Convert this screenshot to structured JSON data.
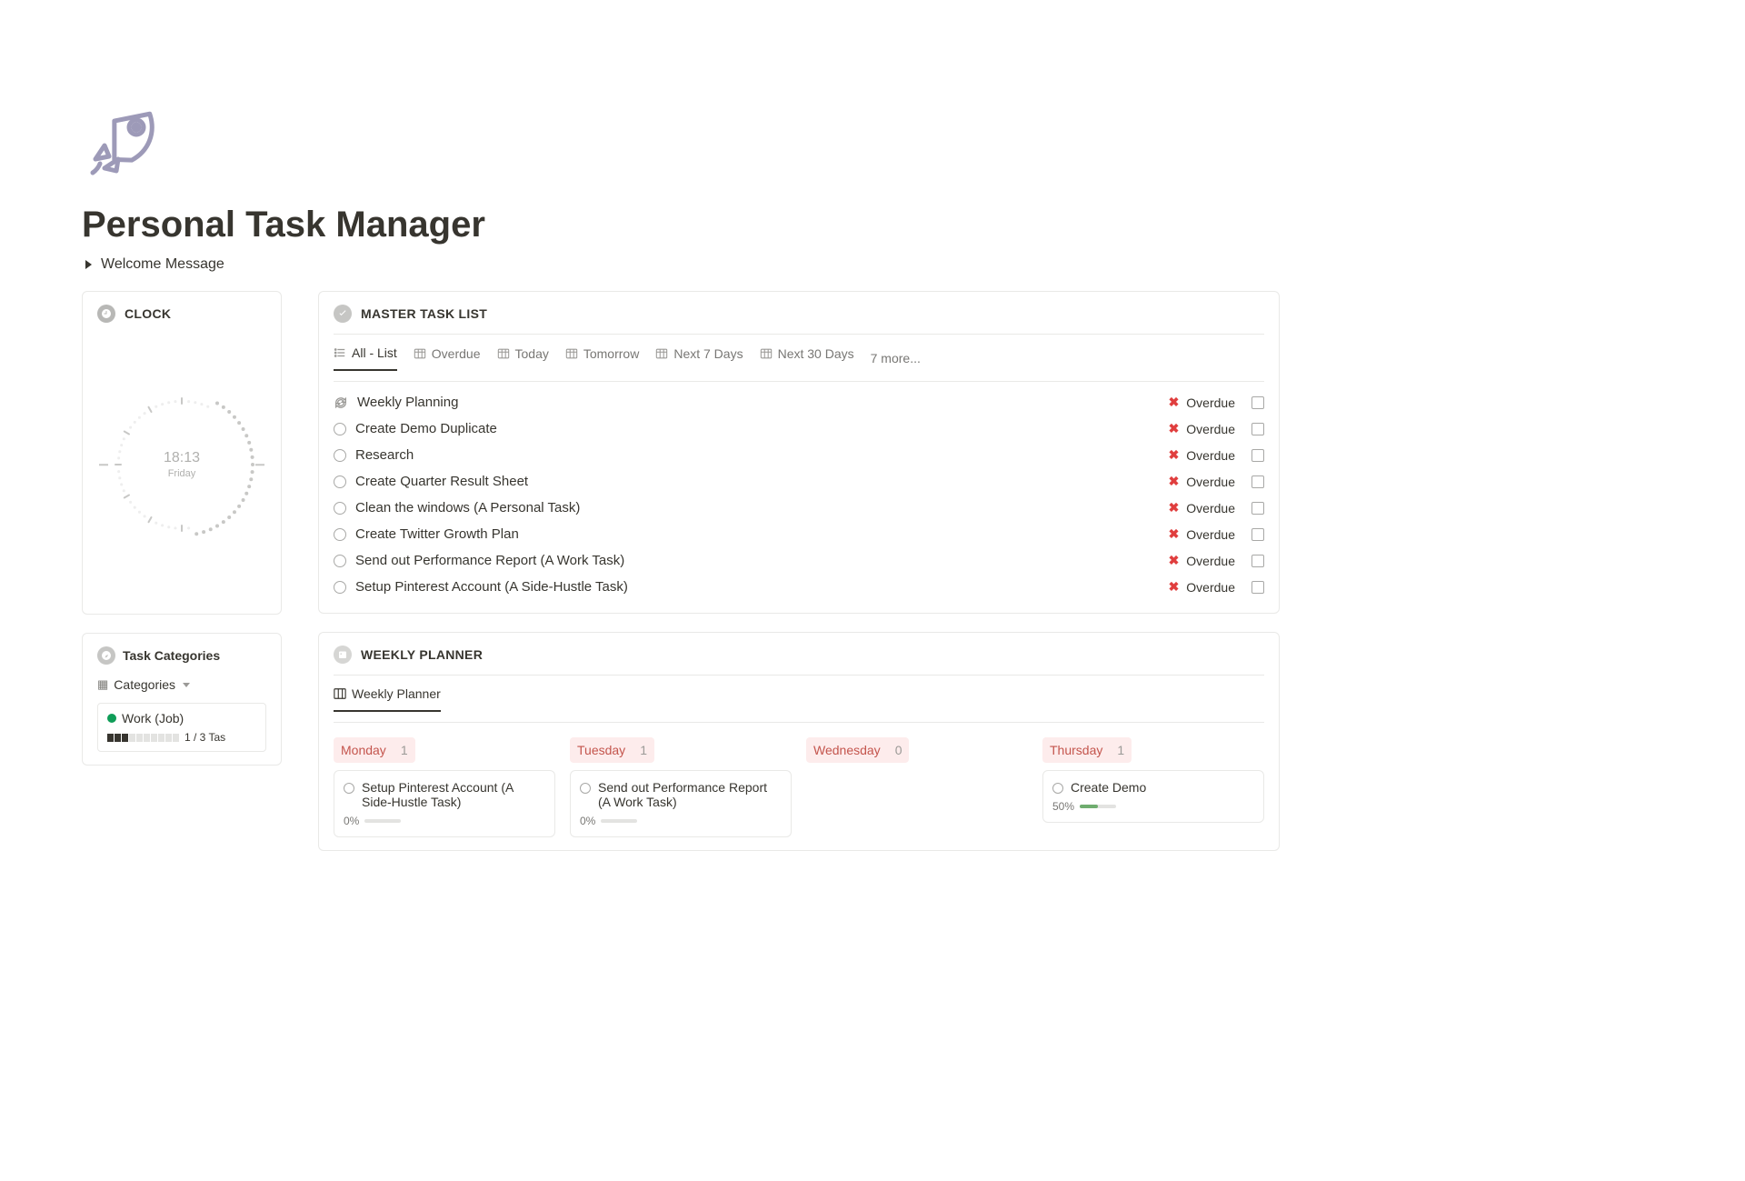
{
  "page": {
    "title": "Personal Task Manager",
    "welcome_label": "Welcome Message"
  },
  "clock": {
    "section_title": "CLOCK",
    "time": "18:13",
    "day": "Friday"
  },
  "task_categories": {
    "section_title": "Task Categories",
    "toggle_label": "Categories",
    "items": [
      {
        "name": "Work (Job)",
        "progress_text": "1 / 3 Tas",
        "filled": 3,
        "total": 10
      }
    ]
  },
  "master": {
    "section_title": "MASTER TASK LIST",
    "tabs": [
      {
        "label": "All - List",
        "icon": "list"
      },
      {
        "label": "Overdue",
        "icon": "table"
      },
      {
        "label": "Today",
        "icon": "table"
      },
      {
        "label": "Tomorrow",
        "icon": "table"
      },
      {
        "label": "Next 7 Days",
        "icon": "table"
      },
      {
        "label": "Next 30 Days",
        "icon": "table"
      }
    ],
    "more_label": "7 more...",
    "status_label": "Overdue",
    "tasks": [
      {
        "title": "Weekly Planning",
        "icon": "sync"
      },
      {
        "title": "Create Demo Duplicate",
        "icon": "circle"
      },
      {
        "title": "Research",
        "icon": "circle"
      },
      {
        "title": "Create Quarter Result Sheet",
        "icon": "circle"
      },
      {
        "title": "Clean the windows (A Personal Task)",
        "icon": "circle"
      },
      {
        "title": "Create Twitter Growth Plan",
        "icon": "circle"
      },
      {
        "title": "Send out Performance Report (A Work Task)",
        "icon": "circle"
      },
      {
        "title": "Setup Pinterest Account (A Side-Hustle Task)",
        "icon": "circle"
      }
    ]
  },
  "planner": {
    "section_title": "WEEKLY PLANNER",
    "tab_label": "Weekly Planner",
    "days": [
      {
        "name": "Monday",
        "count": "1",
        "cards": [
          {
            "title": "Setup Pinterest Account (A Side-Hustle Task)",
            "pct": "0%"
          }
        ]
      },
      {
        "name": "Tuesday",
        "count": "1",
        "cards": [
          {
            "title": "Send out Performance Report (A Work Task)",
            "pct": "0%"
          }
        ]
      },
      {
        "name": "Wednesday",
        "count": "0",
        "cards": []
      },
      {
        "name": "Thursday",
        "count": "1",
        "cards": [
          {
            "title": "Create Demo",
            "pct": "50%"
          }
        ]
      }
    ]
  }
}
